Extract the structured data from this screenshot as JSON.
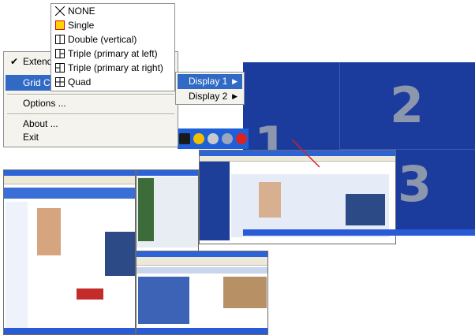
{
  "context_menu": {
    "items": [
      {
        "label": "Extend",
        "checked": true
      },
      {
        "label": "Grid Con",
        "highlighted": true
      },
      {
        "label": "Options ..."
      },
      {
        "label": "About ..."
      },
      {
        "label": "Exit"
      }
    ],
    "check_mark": "✔"
  },
  "grid_submenu": {
    "items": [
      {
        "label": "NONE",
        "icon": "none-icon"
      },
      {
        "label": "Single",
        "icon": "single-icon"
      },
      {
        "label": "Double (vertical)",
        "icon": "double-vertical-icon"
      },
      {
        "label": "Triple (primary at left)",
        "icon": "triple-left-icon"
      },
      {
        "label": "Triple (primary at right)",
        "icon": "triple-right-icon"
      },
      {
        "label": "Quad",
        "icon": "quad-icon"
      }
    ]
  },
  "display_submenu": {
    "items": [
      {
        "label": "Display 1",
        "highlighted": true
      },
      {
        "label": "Display 2"
      }
    ],
    "arrow": "▶"
  },
  "desktop": {
    "zone_numbers": [
      "1",
      "2",
      "3"
    ]
  },
  "colors": {
    "menu_bg": "#f4f3ee",
    "highlight": "#316ac5",
    "desktop_bg": "#1b3c9d",
    "zone_number": "#8c96ad",
    "taskbar": "#2a5bd6"
  }
}
